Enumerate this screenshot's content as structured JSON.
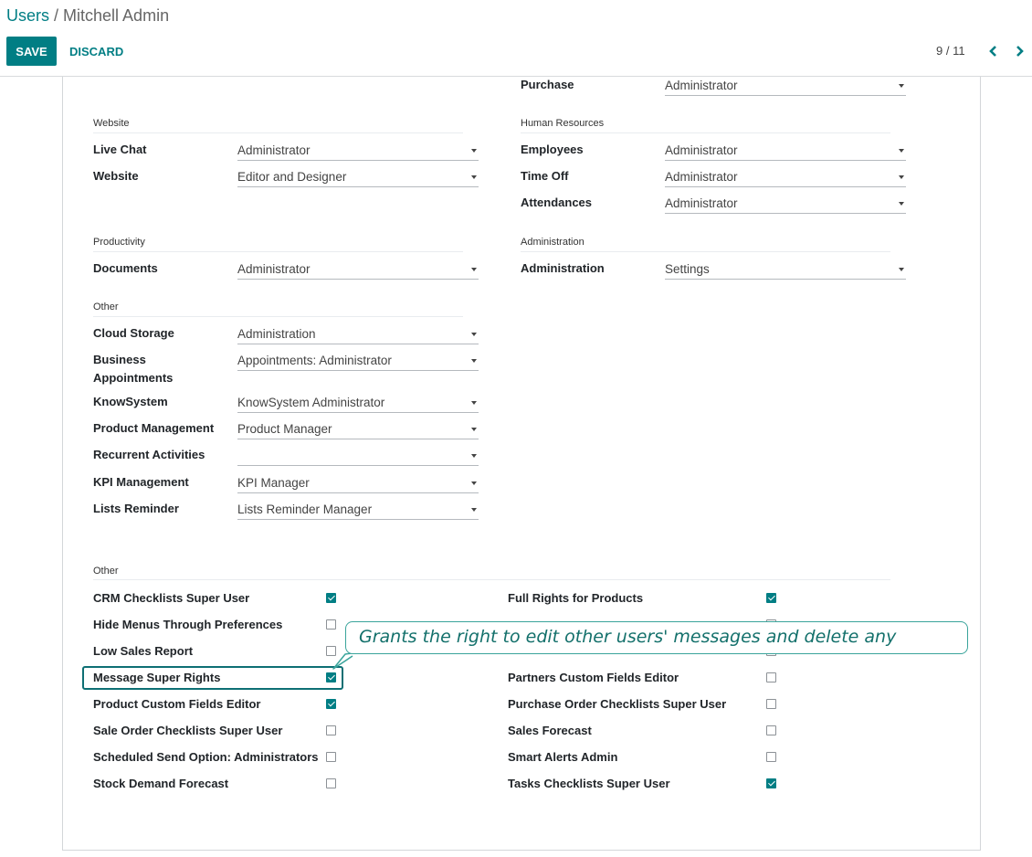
{
  "header": {
    "breadcrumb_parent": "Users",
    "breadcrumb_sep": " / ",
    "breadcrumb_current": "Mitchell Admin",
    "save_label": "SAVE",
    "discard_label": "DISCARD",
    "pager": "9 / 11",
    "prev_icon": "chevron-left-icon",
    "next_icon": "chevron-right-icon"
  },
  "purchase": {
    "label": "Purchase",
    "value": "Administrator"
  },
  "website": {
    "section": "Website",
    "live_chat": {
      "label": "Live Chat",
      "value": "Administrator"
    },
    "website": {
      "label": "Website",
      "value": "Editor and Designer"
    }
  },
  "human_resources": {
    "section": "Human Resources",
    "employees": {
      "label": "Employees",
      "value": "Administrator"
    },
    "time_off": {
      "label": "Time Off",
      "value": "Administrator"
    },
    "attendances": {
      "label": "Attendances",
      "value": "Administrator"
    }
  },
  "productivity": {
    "section": "Productivity",
    "documents": {
      "label": "Documents",
      "value": "Administrator"
    }
  },
  "administration": {
    "section": "Administration",
    "administration": {
      "label": "Administration",
      "value": "Settings"
    }
  },
  "other": {
    "section": "Other",
    "cloud_storage": {
      "label": "Cloud Storage",
      "value": "Administration"
    },
    "business_appointments": {
      "label_line1": "Business",
      "label_line2": "Appointments",
      "value": "Appointments: Administrator"
    },
    "knowsystem": {
      "label": "KnowSystem",
      "value": "KnowSystem Administrator"
    },
    "product_management": {
      "label": "Product Management",
      "value": "Product Manager"
    },
    "recurrent_activities": {
      "label": "Recurrent Activities",
      "value": ""
    },
    "kpi_management": {
      "label": "KPI Management",
      "value": "KPI Manager"
    },
    "lists_reminder": {
      "label": "Lists Reminder",
      "value": "Lists Reminder Manager"
    }
  },
  "other_checks": {
    "section": "Other",
    "left": [
      {
        "label": "CRM Checklists Super User",
        "checked": true
      },
      {
        "label": "Hide Menus Through Preferences",
        "checked": false
      },
      {
        "label": "Low Sales Report",
        "checked": false
      },
      {
        "label": "Message Super Rights",
        "checked": true
      },
      {
        "label": "Product Custom Fields Editor",
        "checked": true
      },
      {
        "label": "Sale Order Checklists Super User",
        "checked": false
      },
      {
        "label": "Scheduled Send Option: Administrators",
        "checked": false
      },
      {
        "label": "Stock Demand Forecast",
        "checked": false
      }
    ],
    "right": [
      {
        "label": "Full Rights for Products",
        "checked": true
      },
      {
        "label": "",
        "checked": false
      },
      {
        "label": "",
        "checked": false
      },
      {
        "label": "Partners Custom Fields Editor",
        "checked": false
      },
      {
        "label": "Purchase Order Checklists Super User",
        "checked": false
      },
      {
        "label": "Sales Forecast",
        "checked": false
      },
      {
        "label": "Smart Alerts Admin",
        "checked": false
      },
      {
        "label": "Tasks Checklists Super User",
        "checked": true
      }
    ]
  },
  "tooltip": {
    "text": "Grants the right to edit other users' messages and delete any"
  },
  "colors": {
    "primary": "#017e84",
    "tooltip_border": "#3aa49b",
    "tooltip_text": "#13706b"
  }
}
